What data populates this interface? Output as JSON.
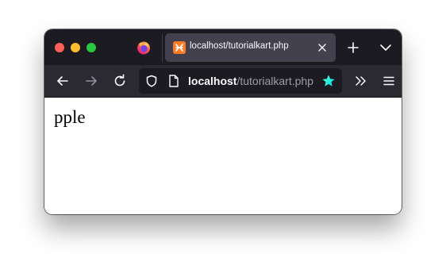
{
  "window": {
    "traffic_lights": [
      "close",
      "minimize",
      "zoom"
    ]
  },
  "tab": {
    "title": "localhost/tutorialkart.php",
    "favicon": "xampp-icon"
  },
  "toolbar": {
    "back": "arrow-left-icon",
    "forward": "arrow-right-icon",
    "reload": "reload-icon",
    "overflow": "chevrons-right-icon",
    "menu": "hamburger-menu-icon"
  },
  "urlbar": {
    "host": "localhost",
    "path": "/tutorialkart.php"
  },
  "page": {
    "text": "pple"
  },
  "colors": {
    "titlebar": "#1c1b22",
    "toolbar": "#2b2a33",
    "tab_active": "#42414d",
    "bookmark_star": "#54ffbd"
  }
}
